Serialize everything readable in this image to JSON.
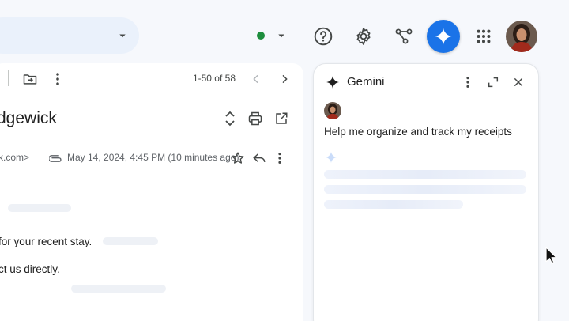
{
  "toolbar": {
    "pagination": "1-50 of 58"
  },
  "message": {
    "subject": "dgewick",
    "sender_email": "k.com>",
    "date": "May 14, 2024, 4:45 PM (10 minutes ago)",
    "body_lines": [
      "for your recent stay.",
      "ct us directly."
    ]
  },
  "gemini": {
    "title": "Gemini",
    "prompt": "Help me organize and track my receipts"
  },
  "colors": {
    "accent": "#1a73e8",
    "status": "#1e8e3e",
    "background": "#f6f8fc"
  }
}
